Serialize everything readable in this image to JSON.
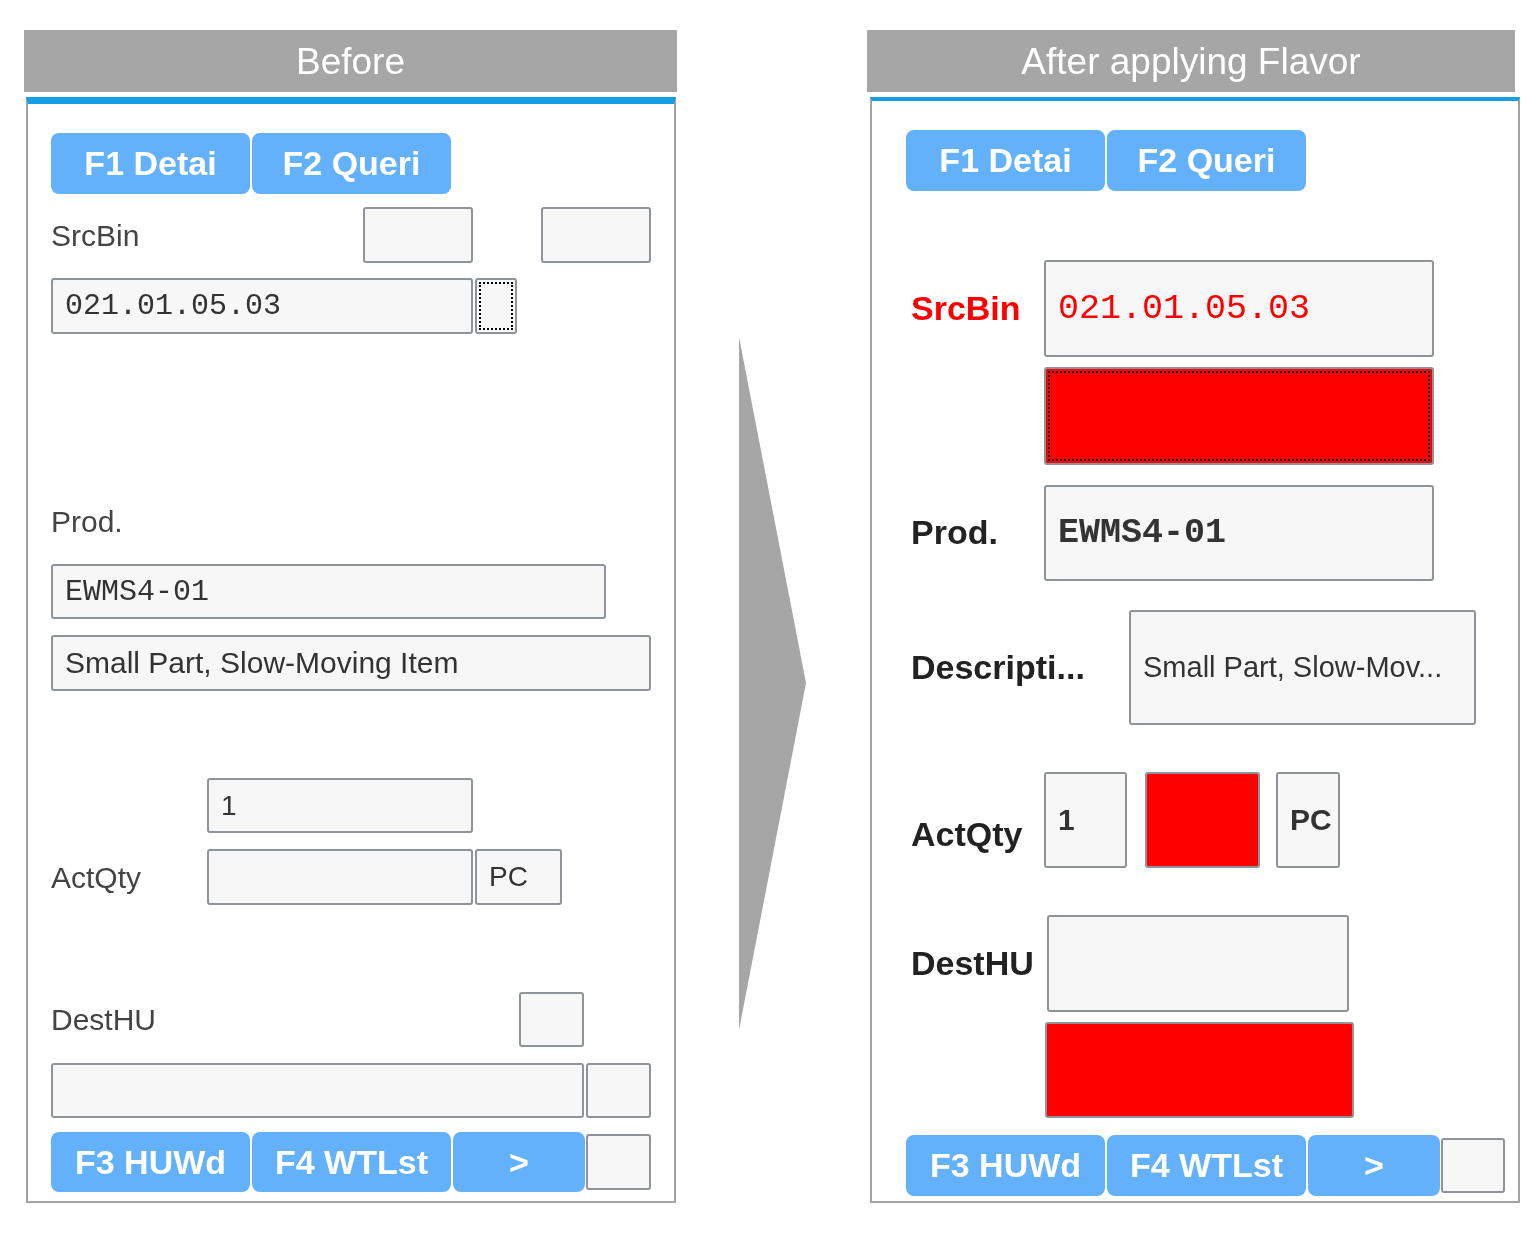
{
  "before": {
    "title": "Before",
    "top_keys": [
      {
        "label": "F1 Detai",
        "kind": "function"
      },
      {
        "label": "F2 Queri",
        "kind": "function"
      }
    ],
    "rows": [
      {
        "label": "SrcBin",
        "fields": [
          {
            "focused": false
          },
          {
            "focused": false
          }
        ]
      },
      {
        "fields": [
          {
            "value": "021.01.05.03",
            "focused": false
          },
          {
            "focused": true
          }
        ]
      },
      {
        "label": "Prod."
      },
      {
        "fields": [
          {
            "value": "EWMS4-01",
            "focused": false
          }
        ]
      },
      {
        "fields": [
          {
            "value": "Small Part, Slow-Moving Item",
            "focused": false
          }
        ]
      },
      {
        "fields": [
          {
            "value": "1",
            "focused": false
          }
        ]
      },
      {
        "label": "ActQty",
        "fields": [
          {
            "focused": false
          },
          {
            "value": "PC",
            "focused": false
          }
        ]
      },
      {
        "label": "DestHU",
        "fields": [
          {
            "focused": false
          }
        ]
      },
      {
        "fields": [
          {
            "focused": false
          },
          {
            "focused": false
          }
        ]
      }
    ],
    "bottom_keys": [
      {
        "label": "F3 HUWd",
        "kind": "function"
      },
      {
        "label": "F4 WTLst",
        "kind": "function"
      },
      {
        "label": ">",
        "kind": "more"
      }
    ],
    "bottom_field": {
      "focused": false
    }
  },
  "after": {
    "title": "After applying Flavor",
    "top_keys": [
      {
        "label": "F1 Detai",
        "kind": "function"
      },
      {
        "label": "F2 Queri",
        "kind": "function"
      }
    ],
    "rows": [
      {
        "label": "SrcBin",
        "emphasized": true,
        "fields": [
          {
            "value": "021.01.05.03",
            "focused": false,
            "highlighted": false
          }
        ]
      },
      {
        "fields": [
          {
            "focused": true,
            "highlighted": true
          }
        ]
      },
      {
        "label": "Prod.",
        "emphasized": false,
        "fields": [
          {
            "value": "EWMS4-01",
            "focused": false,
            "highlighted": false
          }
        ]
      },
      {
        "label": "Descripti...",
        "emphasized": false,
        "fields": [
          {
            "value": "Small Part, Slow-Mov...",
            "focused": false,
            "highlighted": false
          }
        ]
      },
      {
        "label": "ActQty",
        "emphasized": false,
        "fields": [
          {
            "value": "1",
            "focused": false,
            "highlighted": false
          },
          {
            "focused": false,
            "highlighted": true
          },
          {
            "value": "PC",
            "focused": false,
            "highlighted": false
          }
        ]
      },
      {
        "label": "DestHU",
        "emphasized": false,
        "fields": [
          {
            "focused": false,
            "highlighted": false
          }
        ]
      },
      {
        "fields": [
          {
            "focused": false,
            "highlighted": true
          }
        ]
      }
    ],
    "bottom_keys": [
      {
        "label": "F3 HUWd",
        "kind": "function"
      },
      {
        "label": "F4 WTLst",
        "kind": "function"
      },
      {
        "label": ">",
        "kind": "more"
      }
    ],
    "bottom_field": {
      "focused": false,
      "highlighted": false
    }
  }
}
